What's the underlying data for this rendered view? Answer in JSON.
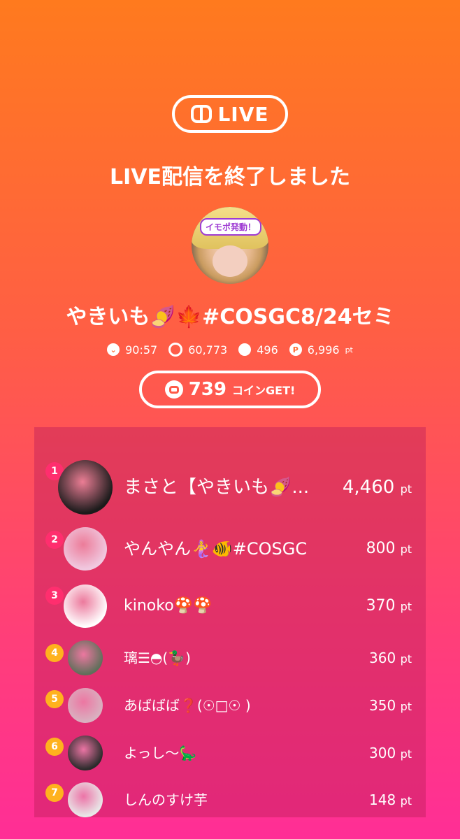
{
  "app": {
    "logo_label": "LIVE"
  },
  "title": "LIVE配信を終了しました",
  "avatar_sticker": "イモポ発動！",
  "streamer_name": "やきいも🍠🍁#COSGC8/24セミ",
  "stats": {
    "duration": "90:57",
    "viewers": "60,773",
    "comments": "496",
    "points": "6,996",
    "points_unit": "pt"
  },
  "coin": {
    "amount": "739",
    "suffix": "コインGET!"
  },
  "ranking": [
    {
      "rank": "1",
      "name": "まさと【やきいも🍠...",
      "points": "4,460",
      "unit": "pt",
      "color": "#1b1b1b"
    },
    {
      "rank": "2",
      "name": "やんやん🧜‍♀️🐠#COSGC",
      "points": "800",
      "unit": "pt",
      "color": "#f0c9e0"
    },
    {
      "rank": "3",
      "name": "kinoko🍄🍄",
      "points": "370",
      "unit": "pt",
      "color": "#ffffff"
    },
    {
      "rank": "4",
      "name": "璃☰◓(🦆)",
      "points": "360",
      "unit": "pt",
      "color": "#5f6f5a"
    },
    {
      "rank": "5",
      "name": "あばばば❓(☉□☉ )",
      "points": "350",
      "unit": "pt",
      "color": "#d9b1c0"
    },
    {
      "rank": "6",
      "name": "よっし〜🦕",
      "points": "300",
      "unit": "pt",
      "color": "#2b2b2b"
    },
    {
      "rank": "7",
      "name": "しんのすけ芋",
      "points": "148",
      "unit": "pt",
      "color": "#e8e8e8"
    }
  ]
}
